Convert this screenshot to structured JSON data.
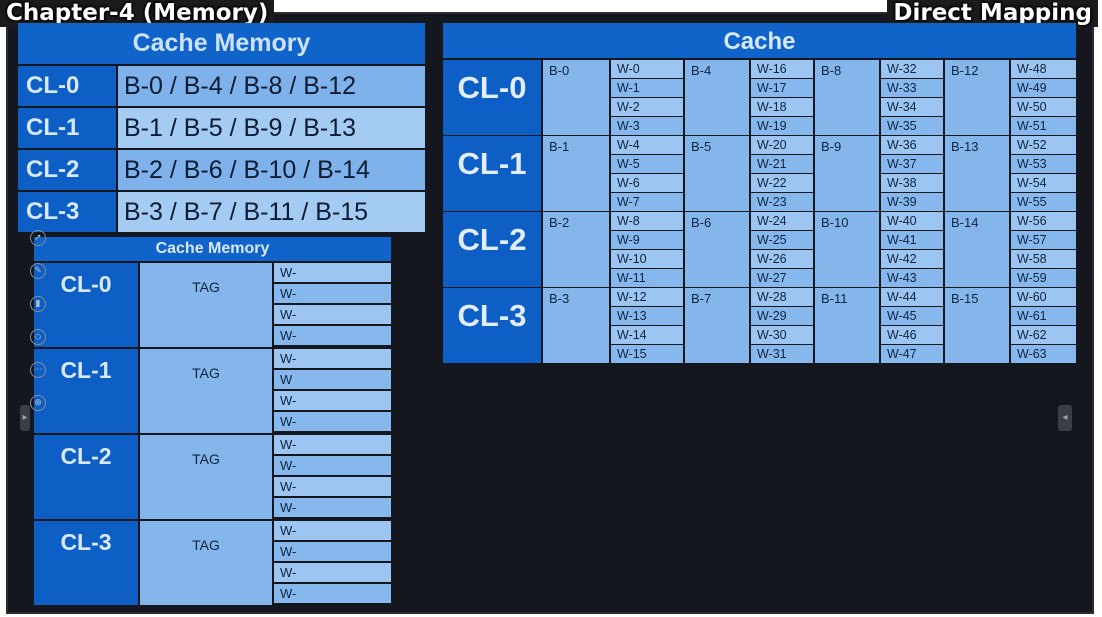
{
  "header": {
    "left_title": "Chapter-4 (Memory)",
    "right_title": "Direct Mapping"
  },
  "mapping_table": {
    "title": "Cache Memory",
    "rows": [
      {
        "line": "CL-0",
        "blocks": "B-0 / B-4 / B-8 / B-12"
      },
      {
        "line": "CL-1",
        "blocks": "B-1 / B-5 / B-9 / B-13"
      },
      {
        "line": "CL-2",
        "blocks": "B-2 / B-6 / B-10 / B-14"
      },
      {
        "line": "CL-3",
        "blocks": "B-3 / B-7 / B-11 / B-15"
      }
    ]
  },
  "cache_memory_small": {
    "title": "Cache Memory",
    "lines": [
      {
        "line": "CL-0",
        "tag": "TAG",
        "words": [
          "W-",
          "W-",
          "W-",
          "W-"
        ]
      },
      {
        "line": "CL-1",
        "tag": "TAG",
        "words": [
          "W-",
          "W",
          "W-",
          "W-"
        ]
      },
      {
        "line": "CL-2",
        "tag": "TAG",
        "words": [
          "W-",
          "W-",
          "W-",
          "W-"
        ]
      },
      {
        "line": "CL-3",
        "tag": "TAG",
        "words": [
          "W-",
          "W-",
          "W-",
          "W-"
        ]
      }
    ]
  },
  "cache_grid": {
    "title": "Cache",
    "lines": [
      {
        "line": "CL-0",
        "blocks": [
          {
            "block": "B-0",
            "words": [
              "W-0",
              "W-1",
              "W-2",
              "W-3"
            ]
          },
          {
            "block": "B-4",
            "words": [
              "W-16",
              "W-17",
              "W-18",
              "W-19"
            ]
          },
          {
            "block": "B-8",
            "words": [
              "W-32",
              "W-33",
              "W-34",
              "W-35"
            ]
          },
          {
            "block": "B-12",
            "words": [
              "W-48",
              "W-49",
              "W-50",
              "W-51"
            ]
          }
        ]
      },
      {
        "line": "CL-1",
        "blocks": [
          {
            "block": "B-1",
            "words": [
              "W-4",
              "W-5",
              "W-6",
              "W-7"
            ]
          },
          {
            "block": "B-5",
            "words": [
              "W-20",
              "W-21",
              "W-22",
              "W-23"
            ]
          },
          {
            "block": "B-9",
            "words": [
              "W-36",
              "W-37",
              "W-38",
              "W-39"
            ]
          },
          {
            "block": "B-13",
            "words": [
              "W-52",
              "W-53",
              "W-54",
              "W-55"
            ]
          }
        ]
      },
      {
        "line": "CL-2",
        "blocks": [
          {
            "block": "B-2",
            "words": [
              "W-8",
              "W-9",
              "W-10",
              "W-11"
            ]
          },
          {
            "block": "B-6",
            "words": [
              "W-24",
              "W-25",
              "W-26",
              "W-27"
            ]
          },
          {
            "block": "B-10",
            "words": [
              "W-40",
              "W-41",
              "W-42",
              "W-43"
            ]
          },
          {
            "block": "B-14",
            "words": [
              "W-56",
              "W-57",
              "W-58",
              "W-59"
            ]
          }
        ]
      },
      {
        "line": "CL-3",
        "blocks": [
          {
            "block": "B-3",
            "words": [
              "W-12",
              "W-13",
              "W-14",
              "W-15"
            ]
          },
          {
            "block": "B-7",
            "words": [
              "W-28",
              "W-29",
              "W-30",
              "W-31"
            ]
          },
          {
            "block": "B-11",
            "words": [
              "W-44",
              "W-45",
              "W-46",
              "W-47"
            ]
          },
          {
            "block": "B-15",
            "words": [
              "W-60",
              "W-61",
              "W-62",
              "W-63"
            ]
          }
        ]
      }
    ]
  },
  "toolbar_icons": [
    "cursor-icon",
    "pen-icon",
    "highlighter-icon",
    "eraser-icon",
    "more-icon",
    "zoom-icon"
  ]
}
